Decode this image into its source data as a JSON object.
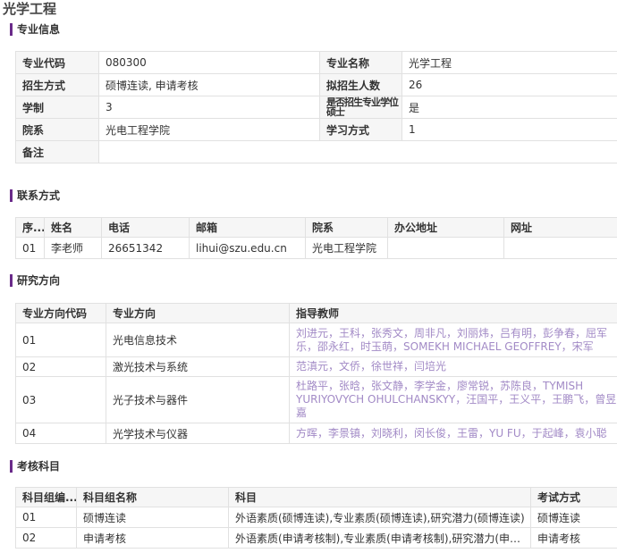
{
  "page": {
    "title": "光学工程"
  },
  "sections": {
    "info": "专业信息",
    "contact": "联系方式",
    "research": "研究方向",
    "exam": "考核科目"
  },
  "info": {
    "code_label": "专业代码",
    "code": "080300",
    "name_label": "专业名称",
    "name": "光学工程",
    "mode_label": "招生方式",
    "mode": "硕博连读, 申请考核",
    "quota_label": "拟招生人数",
    "quota": "26",
    "years_label": "学制",
    "years": "3",
    "degree_label": "是否招生专业学位硕士",
    "degree": "是",
    "dept_label": "院系",
    "dept": "光电工程学院",
    "study_label": "学习方式",
    "study": "1",
    "note_label": "备注",
    "note": ""
  },
  "contact": {
    "headers": [
      "序...",
      "姓名",
      "电话",
      "邮箱",
      "院系",
      "办公地址",
      "网址"
    ],
    "row": {
      "no": "01",
      "name": "李老师",
      "phone": "26651342",
      "email": "lihui@szu.edu.cn",
      "dept": "光电工程学院",
      "office": "",
      "url": ""
    }
  },
  "research": {
    "headers": [
      "专业方向代码",
      "专业方向",
      "指导教师"
    ],
    "rows": [
      {
        "code": "01",
        "dir": "光电信息技术",
        "teachers": "刘进元，王科，张秀文，周非凡，刘丽炜，吕有明，彭争春，屈军乐，邵永红，时玉萌，SOMEKH MICHAEL GEOFFREY，宋军"
      },
      {
        "code": "02",
        "dir": "激光技术与系统",
        "teachers": "范滇元，文侨，徐世祥，闫培光"
      },
      {
        "code": "03",
        "dir": "光子技术与器件",
        "teachers": "杜路平，张晗，张文静，李学金，廖常锐，苏陈良，TYMISH YURIYOVYCH OHULCHANSKYY，汪国平，王义平，王鹏飞，曾昱嘉"
      },
      {
        "code": "04",
        "dir": "光学技术与仪器",
        "teachers": "方晖，李景镇，刘晓利，闵长俊，王雷，YU FU，于起峰，袁小聪"
      }
    ]
  },
  "exam": {
    "headers": [
      "科目组编...",
      "科目组名称",
      "科目",
      "考试方式"
    ],
    "rows": [
      {
        "code": "01",
        "name": "硕博连读",
        "subjects": "外语素质(硕博连读),专业素质(硕博连读),研究潜力(硕博连读)",
        "method": "硕博连读"
      },
      {
        "code": "02",
        "name": "申请考核",
        "subjects": "外语素质(申请考核制),专业素质(申请考核制),研究潜力(申请...",
        "method": "申请考核"
      }
    ]
  },
  "colors": {
    "accent": "#6a2b8a",
    "teacher_link": "#a28ac6",
    "header_bg": "#f6f6f6",
    "border": "#e1e1e1"
  }
}
